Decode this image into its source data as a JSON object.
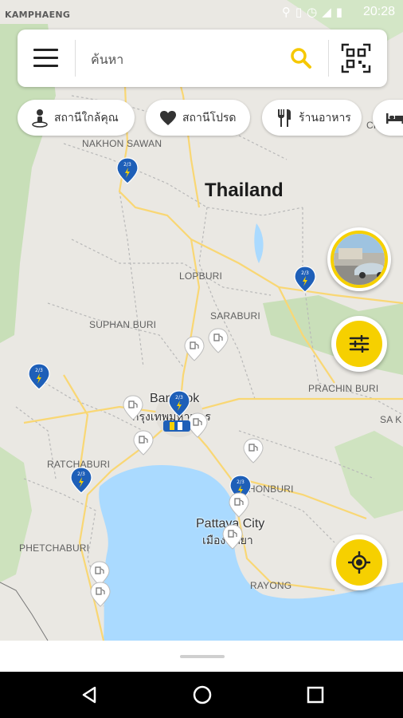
{
  "status": {
    "carrier": "KAMPHAENG",
    "time": "20:28",
    "icons": [
      "location-icon",
      "vibrate-icon",
      "alarm-icon",
      "signal-icon",
      "battery-icon"
    ]
  },
  "search": {
    "placeholder": "ค้นหา",
    "value": ""
  },
  "chips": [
    {
      "label": "สถานีใกล้คุณ",
      "icon": "person-pin-icon"
    },
    {
      "label": "สถานีโปรด",
      "icon": "heart-icon"
    },
    {
      "label": "ร้านอาหาร",
      "icon": "restaurant-icon"
    },
    {
      "label": "",
      "icon": "hotel-icon"
    }
  ],
  "map": {
    "country": "Thailand",
    "labels": {
      "kamphaeng": "KAMPHAENG",
      "nakhon_sawan": "NAKHON SAWAN",
      "lopburi": "LOPBURI",
      "saraburi": "SARABURI",
      "suphan_buri": "SUPHAN BURI",
      "prachin_buri": "PRACHIN BURI",
      "ratchaburi": "RATCHABURI",
      "phetchaburi": "PHETCHABURI",
      "rayong": "RAYONG",
      "sa_k": "SA K",
      "ch_top": "CH",
      "chonburi": "CHONBURI",
      "bangkok": "Bangkok",
      "bangkok_th": "กรุงเทพมหานคร",
      "pattaya": "Pattaya City",
      "pattaya_th": "เมืองพัทยา"
    },
    "pin_label": "2/3"
  },
  "colors": {
    "accent": "#f6d000",
    "pin_blue": "#1e5fb8",
    "water": "#aadaff",
    "land": "#eae8e3",
    "forest": "#c8dfb8",
    "road": "#f9d774"
  }
}
